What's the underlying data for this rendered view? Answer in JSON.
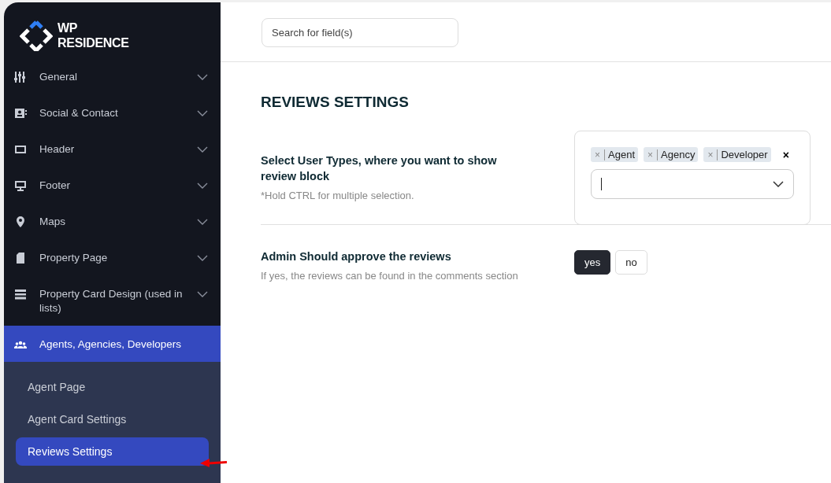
{
  "logo": {
    "line_1": "WP",
    "line_2": "RESIDENCE"
  },
  "sidebar": {
    "items": [
      {
        "label": "General",
        "kind": "sliders",
        "expanded": false,
        "selected": false
      },
      {
        "label": "Social & Contact",
        "kind": "contact",
        "expanded": false,
        "selected": false
      },
      {
        "label": "Header",
        "kind": "laptop",
        "expanded": false,
        "selected": false
      },
      {
        "label": "Footer",
        "kind": "monitor",
        "expanded": false,
        "selected": false
      },
      {
        "label": "Maps",
        "kind": "pin",
        "expanded": false,
        "selected": false
      },
      {
        "label": "Property Page",
        "kind": "file",
        "expanded": false,
        "selected": false
      },
      {
        "label": "Property Card Design (used in lists)",
        "kind": "bars",
        "expanded": false,
        "selected": false
      },
      {
        "label": "Agents, Agencies, Developers",
        "kind": "users",
        "expanded": true,
        "selected": true,
        "children": [
          {
            "label": "Agent Page",
            "selected": false
          },
          {
            "label": "Agent Card Settings",
            "selected": false
          },
          {
            "label": "Reviews Settings",
            "selected": true
          }
        ]
      }
    ]
  },
  "search": {
    "placeholder": "Search for field(s)"
  },
  "page_title": "REVIEWS SETTINGS",
  "settings": [
    {
      "kind": "multiselect",
      "label": "Select User Types, where you want to show review block",
      "hint": "*Hold CTRL for multiple selection.",
      "chips": [
        {
          "remove": "×",
          "label": "Agent"
        },
        {
          "remove": "×",
          "label": "Agency"
        },
        {
          "remove": "×",
          "label": "Developer"
        }
      ],
      "clear": "×"
    },
    {
      "kind": "toggle",
      "label": "Admin Should approve the reviews",
      "hint": "If yes, the reviews can be found in the comments section",
      "options": [
        {
          "label": "yes",
          "selected": true
        },
        {
          "label": "no",
          "selected": false
        }
      ]
    }
  ]
}
